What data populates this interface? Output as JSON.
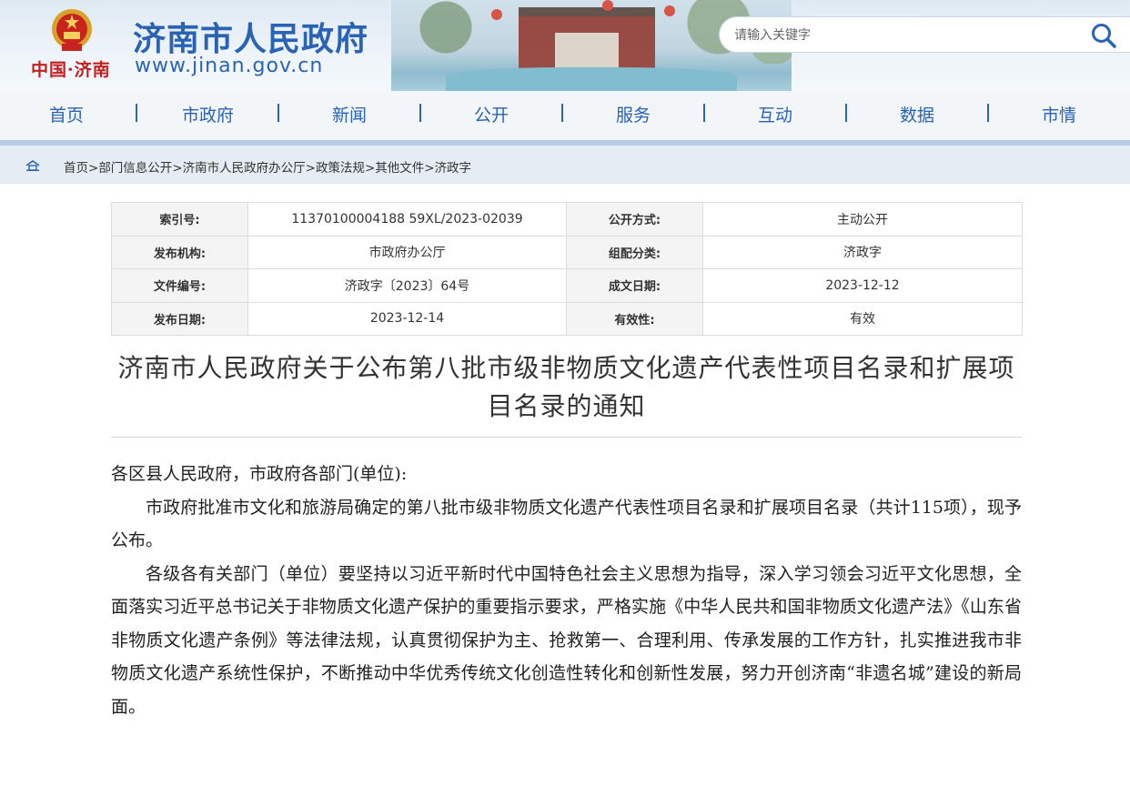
{
  "header": {
    "site_title": "济南市人民政府",
    "site_url": "www.jinan.gov.cn",
    "city_brand": "中国·济南",
    "search": {
      "placeholder": "请输入关键字"
    }
  },
  "nav": {
    "items": [
      {
        "label": "首页"
      },
      {
        "label": "市政府"
      },
      {
        "label": "新闻"
      },
      {
        "label": "公开"
      },
      {
        "label": "服务"
      },
      {
        "label": "互动"
      },
      {
        "label": "数据"
      },
      {
        "label": "市情"
      }
    ]
  },
  "breadcrumb": {
    "items": [
      "首页",
      "部门信息公开",
      "济南市人民政府办公厅",
      "政策法规",
      "其他文件",
      "济政字"
    ],
    "separator": ">"
  },
  "meta_table": {
    "rows": [
      {
        "k1": "索引号:",
        "v1": "11370100004188 59XL/2023-02039",
        "k2": "公开方式:",
        "v2": "主动公开"
      },
      {
        "k1": "发布机构:",
        "v1": "市政府办公厅",
        "k2": "组配分类:",
        "v2": "济政字"
      },
      {
        "k1": "文件编号:",
        "v1": "济政字〔2023〕64号",
        "k2": "成文日期:",
        "v2": "2023-12-12"
      },
      {
        "k1": "发布日期:",
        "v1": "2023-12-14",
        "k2": "有效性:",
        "v2": "有效"
      }
    ]
  },
  "document": {
    "title": "济南市人民政府关于公布第八批市级非物质文化遗产代表性项目名录和扩展项目名录的通知",
    "salutation": "各区县人民政府，市政府各部门(单位):",
    "paragraphs": [
      "市政府批准市文化和旅游局确定的第八批市级非物质文化遗产代表性项目名录和扩展项目名录（共计115项），现予公布。",
      "各级各有关部门（单位）要坚持以习近平新时代中国特色社会主义思想为指导，深入学习领会习近平文化思想，全面落实习近平总书记关于非物质文化遗产保护的重要指示要求，严格实施《中华人民共和国非物质文化遗产法》《山东省非物质文化遗产条例》等法律法规，认真贯彻保护为主、抢救第一、合理利用、传承发展的工作方针，扎实推进我市非物质文化遗产系统性保护，不断推动中华优秀传统文化创造性转化和创新性发展，努力开创济南“非遗名城”建设的新局面。"
    ]
  },
  "colors": {
    "brand_blue": "#2a63b4",
    "brand_red": "#c0211e",
    "nav_bar": "#b8cbe3",
    "crumb_bg": "#e6ecf3"
  },
  "icons": {
    "emblem": "national-emblem-icon",
    "search": "search-icon",
    "home": "home-icon"
  }
}
